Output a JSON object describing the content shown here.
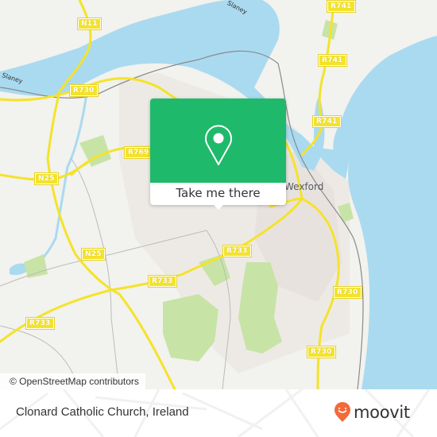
{
  "map": {
    "place_labels": {
      "town": "Wexford",
      "river": "Slaney",
      "river2": "Slaney"
    },
    "road_shields": [
      {
        "id": "n11",
        "label": "N11"
      },
      {
        "id": "r730-nw",
        "label": "R730"
      },
      {
        "id": "r741-top",
        "label": "R741"
      },
      {
        "id": "r741-mid",
        "label": "R741"
      },
      {
        "id": "r741-low",
        "label": "R741"
      },
      {
        "id": "r769",
        "label": "R769"
      },
      {
        "id": "n25-w",
        "label": "N25"
      },
      {
        "id": "n25-s",
        "label": "N25"
      },
      {
        "id": "r733-c",
        "label": "R733"
      },
      {
        "id": "r733-m",
        "label": "R733"
      },
      {
        "id": "r733-sw",
        "label": "R733"
      },
      {
        "id": "r730-e",
        "label": "R730"
      },
      {
        "id": "r730-se",
        "label": "R730"
      }
    ],
    "attribution": "© OpenStreetMap contributors",
    "colors": {
      "land": "#f2f2ee",
      "water": "#aadaf0",
      "park": "#c8e3a6",
      "urban": "#e6e0dc",
      "road": "#f4e32a"
    }
  },
  "popup": {
    "button_label": "Take me there",
    "icon": "map-pin-icon",
    "color": "#1fb96b"
  },
  "footer": {
    "title": "Clonard Catholic Church, Ireland",
    "brand": "moovit",
    "brand_icon": "moovit-pin-icon",
    "brand_color": "#f26b3a"
  }
}
